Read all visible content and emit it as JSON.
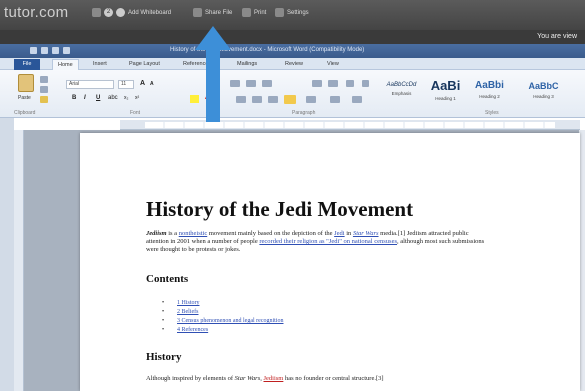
{
  "share_toolbar": {
    "brand": "tutor.com",
    "items": [
      {
        "label": "Add Whiteboard",
        "icon": "whiteboard-icon"
      },
      {
        "label": "Share File",
        "icon": "share-file-icon"
      },
      {
        "label": "Print",
        "icon": "print-icon"
      },
      {
        "label": "Settings",
        "icon": "settings-icon"
      }
    ],
    "counter": "2",
    "notice": "You are view"
  },
  "word": {
    "title": "History of the Jedi Movement.docx - Microsoft Word (Compatibility Mode)",
    "tabs": [
      "File",
      "Home",
      "Insert",
      "Page Layout",
      "References",
      "Mailings",
      "Review",
      "View"
    ],
    "active_tab": "Home",
    "clipboard": {
      "paste_label": "Paste",
      "group_label": "Clipboard"
    },
    "font": {
      "name": "Arial",
      "size": "11",
      "group_label": "Font"
    },
    "paragraph_group_label": "Paragraph",
    "styles": [
      {
        "sample": "AaBbCcDd",
        "name": "Emphasis"
      },
      {
        "sample": "AaBi",
        "name": "Heading 1"
      },
      {
        "sample": "AaBbi",
        "name": "Heading 2"
      },
      {
        "sample": "AaBbC",
        "name": "Heading 3"
      }
    ],
    "styles_group_label": "Styles"
  },
  "document": {
    "title": "History of the Jedi Movement",
    "intro": {
      "term": "Jediism",
      "p1": " is a ",
      "link1": "nontheistic",
      "p2": " movement mainly based on the depiction of the ",
      "link2": "Jedi",
      "p3": " in ",
      "link3": "Star Wars",
      "p4": " media.[1] Jediism attracted public attention in 2001 when a number of people ",
      "link4": "recorded their religion as \"Jedi\" on national censuses",
      "p5": ", although most such submissions were thought to be protests or jokes."
    },
    "contents_heading": "Contents",
    "toc": [
      "1 History",
      "2 Beliefs",
      "3 Census phenomenon and legal recognition",
      "4 References"
    ],
    "history_heading": "History",
    "history_line": {
      "p1": "Although inspired by elements of ",
      "it": "Star Wars",
      "p2": ", ",
      "red": "Jediism",
      "p3": " has no founder or central structure.[3]"
    }
  },
  "colors": {
    "arrow": "#3d8fd8",
    "file_tab": "#2a5699",
    "link": "#2f4fb4"
  }
}
